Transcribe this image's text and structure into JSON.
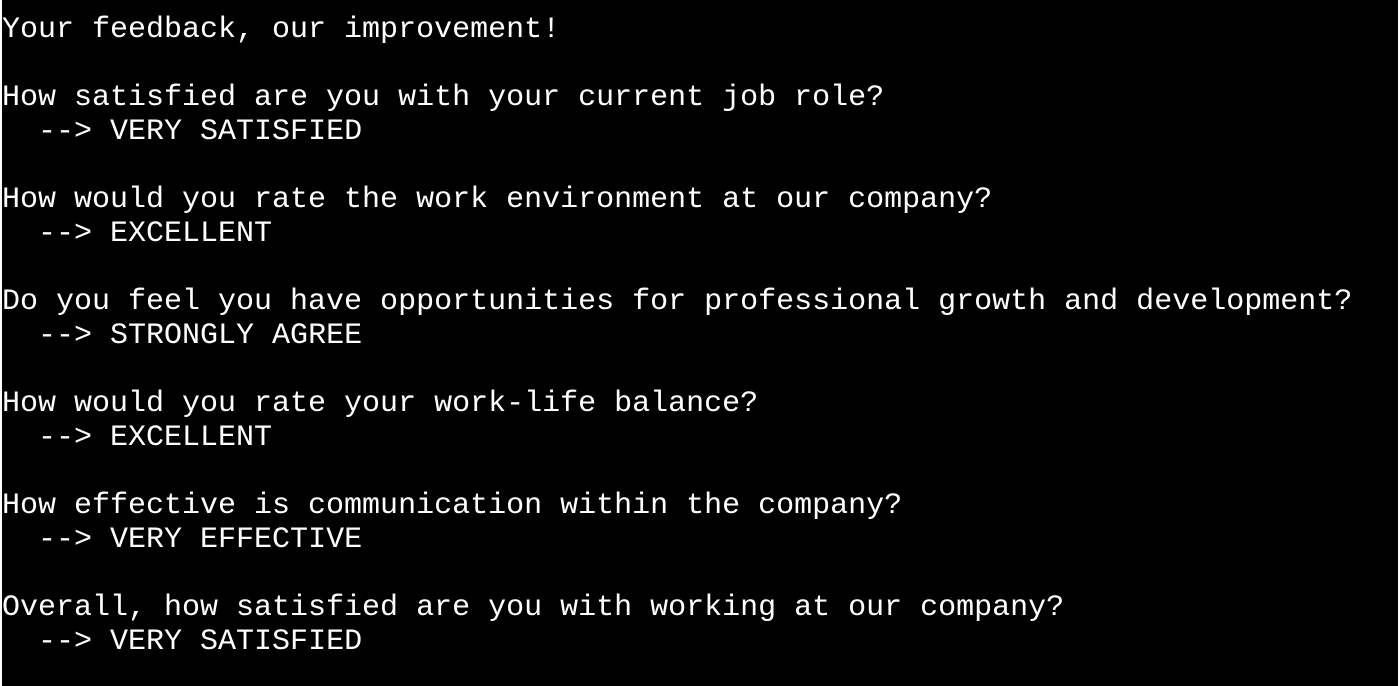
{
  "terminal": {
    "intro": "Your feedback, our improvement!",
    "arrow": "-->",
    "items": [
      {
        "question": "How satisfied are you with your current job role?",
        "answer": "VERY SATISFIED"
      },
      {
        "question": "How would you rate the work environment at our company?",
        "answer": "EXCELLENT"
      },
      {
        "question": "Do you feel you have opportunities for professional growth and development?",
        "answer": "STRONGLY AGREE"
      },
      {
        "question": "How would you rate your work-life balance?",
        "answer": "EXCELLENT"
      },
      {
        "question": "How effective is communication within the company?",
        "answer": "VERY EFFECTIVE"
      },
      {
        "question": "Overall, how satisfied are you with working at our company?",
        "answer": "VERY SATISFIED"
      }
    ]
  }
}
